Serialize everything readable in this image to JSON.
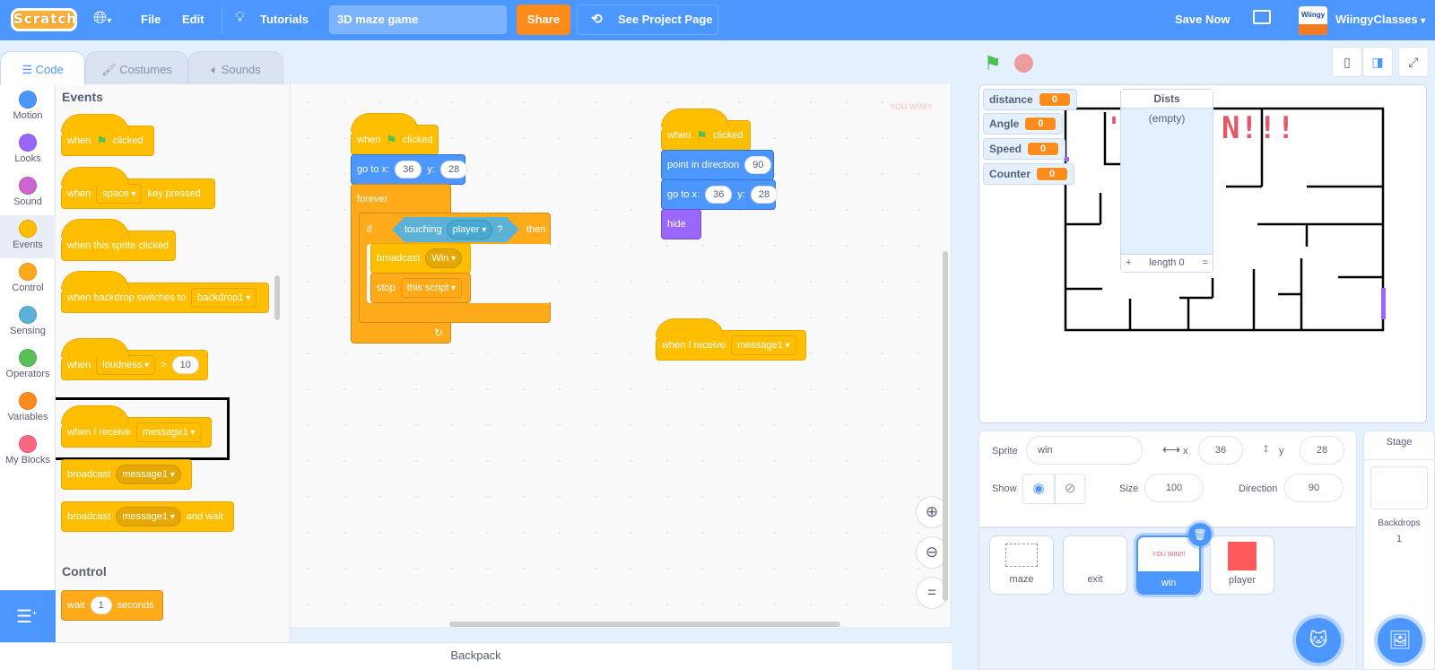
{
  "menubar": {
    "logo": "Scratch",
    "file": "File",
    "edit": "Edit",
    "tutorials": "Tutorials",
    "project_title": "3D maze game",
    "share": "Share",
    "see_project_page": "See Project Page",
    "save_now": "Save Now",
    "username": "WiingyClasses"
  },
  "tabs": [
    {
      "label": "Code"
    },
    {
      "label": "Costumes"
    },
    {
      "label": "Sounds"
    }
  ],
  "categories": [
    {
      "label": "Motion",
      "color": "#4c97ff"
    },
    {
      "label": "Looks",
      "color": "#9966ff"
    },
    {
      "label": "Sound",
      "color": "#cf63cf"
    },
    {
      "label": "Events",
      "color": "#ffbf00"
    },
    {
      "label": "Control",
      "color": "#ffab19"
    },
    {
      "label": "Sensing",
      "color": "#5cb1d6"
    },
    {
      "label": "Operators",
      "color": "#59c059"
    },
    {
      "label": "Variables",
      "color": "#ff8c1a"
    },
    {
      "label": "My Blocks",
      "color": "#ff6680"
    }
  ],
  "palette": {
    "events_heading": "Events",
    "control_heading": "Control",
    "b1": {
      "a": "when",
      "b": "clicked"
    },
    "b2": {
      "a": "when",
      "dd": "space",
      "b": "key pressed"
    },
    "b3": {
      "a": "when this sprite clicked"
    },
    "b4": {
      "a": "when backdrop switches to",
      "dd": "backdrop1"
    },
    "b5": {
      "a": "when",
      "dd": "loudness",
      "op": ">",
      "num": "10"
    },
    "b6": {
      "a": "when I receive",
      "dd": "message1"
    },
    "b7": {
      "a": "broadcast",
      "dd": "message1"
    },
    "b8": {
      "a": "broadcast",
      "dd": "message1",
      "b": "and wait"
    },
    "b9": {
      "a": "wait",
      "num": "1",
      "b": "seconds"
    }
  },
  "script1": {
    "hat": {
      "a": "when",
      "b": "clicked"
    },
    "goto": {
      "a": "go to x:",
      "x": "36",
      "yl": "y:",
      "y": "28"
    },
    "forever": "forever",
    "if": {
      "a": "if",
      "touching": "touching",
      "dd": "player",
      "q": "?",
      "then": "then"
    },
    "broadcast": {
      "a": "broadcast",
      "dd": "Win"
    },
    "stop": {
      "a": "stop",
      "dd": "this script"
    }
  },
  "script2": {
    "hat": {
      "a": "when",
      "b": "clicked"
    },
    "point": {
      "a": "point in direction",
      "v": "90"
    },
    "goto": {
      "a": "go to x:",
      "x": "36",
      "yl": "y:",
      "y": "28"
    },
    "hide": "hide"
  },
  "script3": {
    "a": "when I receive",
    "dd": "message1"
  },
  "code_watermark": "YOU WIN!!!",
  "backpack": "Backpack",
  "stage": {
    "monitors": [
      {
        "label": "distance",
        "value": "0"
      },
      {
        "label": "Angle",
        "value": "0"
      },
      {
        "label": "Speed",
        "value": "0"
      },
      {
        "label": "Counter",
        "value": "0"
      }
    ],
    "list": {
      "title": "Dists",
      "empty": "(empty)",
      "add": "+",
      "length": "length 0",
      "resize": "="
    },
    "win_text": "N!!!"
  },
  "sprite_info": {
    "sprite_label": "Sprite",
    "sprite_name": "win",
    "x_label": "x",
    "x": "36",
    "y_label": "y",
    "y": "28",
    "show_label": "Show",
    "size_label": "Size",
    "size": "100",
    "direction_label": "Direction",
    "direction": "90"
  },
  "sprites": [
    {
      "name": "maze"
    },
    {
      "name": "exit"
    },
    {
      "name": "win",
      "thumb_text": "YOU WIN!!!"
    },
    {
      "name": "player",
      "color": "#ff5959"
    }
  ],
  "stage_panel": {
    "title": "Stage",
    "backdrops_label": "Backdrops",
    "backdrops_count": "1"
  }
}
